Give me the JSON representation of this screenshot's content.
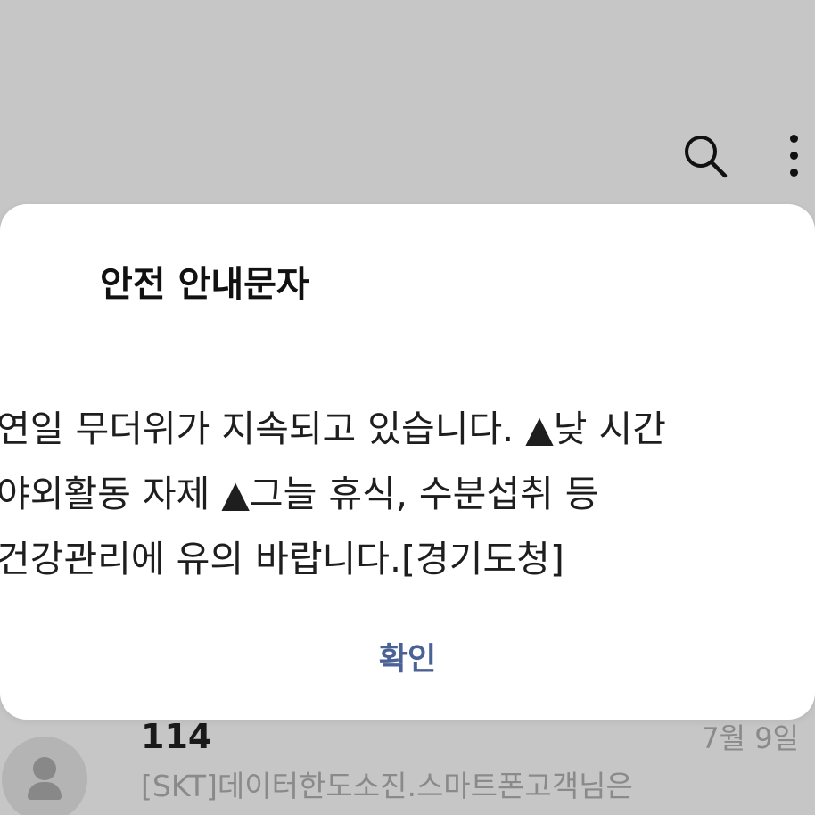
{
  "toolbar": {
    "search_icon": "search-icon",
    "more_icon": "more-vertical-icon"
  },
  "message_list": {
    "items": [
      {
        "sender": "114",
        "date": "7월 9일",
        "preview": "[SKT]데이터한도소진.스마트폰고객님은",
        "avatar_icon": "person-icon"
      }
    ]
  },
  "dialog": {
    "title": "안전 안내문자",
    "body_lines": [
      "연일 무더위가 지속되고 있습니다. ▲낮 시간",
      "야외활동 자제 ▲그늘 휴식, 수분섭취 등",
      "건강관리에 유의 바랍니다.[경기도청]"
    ],
    "confirm_label": "확인"
  },
  "colors": {
    "background": "#c6c6c6",
    "dialog_background": "#ffffff",
    "confirm_accent": "#4a6295",
    "secondary_text": "#8a8a8a",
    "avatar_background": "#b4b4b4"
  }
}
